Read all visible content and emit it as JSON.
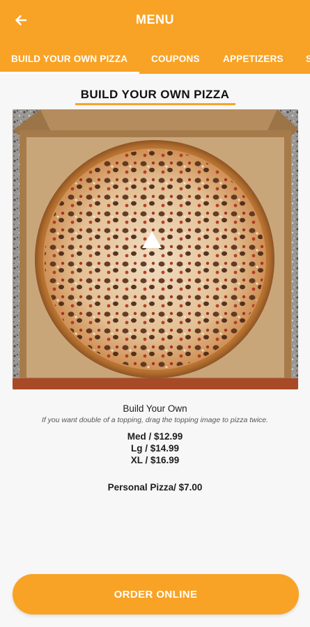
{
  "appbar": {
    "title": "MENU",
    "back_icon": "arrow-left-icon",
    "color": "#f8a325"
  },
  "tabs": [
    {
      "label": "BUILD YOUR OWN PIZZA",
      "selected": true
    },
    {
      "label": "COUPONS",
      "selected": false
    },
    {
      "label": "APPETIZERS",
      "selected": false
    },
    {
      "label": "S",
      "selected": false
    }
  ],
  "section": {
    "title": "BUILD YOUR OWN PIZZA"
  },
  "item": {
    "name": "Build Your Own",
    "note": "If you want double of a topping, drag the topping image to pizza twice.",
    "prices": [
      "Med / $12.99",
      "Lg / $14.99",
      "XL / $16.99"
    ],
    "personal": "Personal Pizza/ $7.00"
  },
  "order_button": {
    "label": "ORDER ONLINE"
  }
}
